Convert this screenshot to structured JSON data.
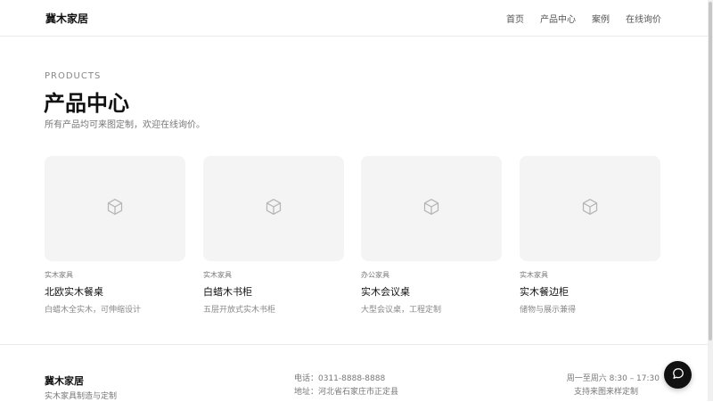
{
  "header": {
    "brand": "冀木家居",
    "nav": [
      {
        "label": "首页"
      },
      {
        "label": "产品中心"
      },
      {
        "label": "案例"
      },
      {
        "label": "在线询价"
      }
    ]
  },
  "hero": {
    "eyebrow": "PRODUCTS",
    "title": "产品中心",
    "subtitle": "所有产品均可来图定制，欢迎在线询价。"
  },
  "products": [
    {
      "category": "实木家具",
      "name": "北欧实木餐桌",
      "desc": "白蜡木全实木，可伸缩设计",
      "icon": "box-icon"
    },
    {
      "category": "实木家具",
      "name": "白蜡木书柜",
      "desc": "五层开放式实木书柜",
      "icon": "box-icon"
    },
    {
      "category": "办公家具",
      "name": "实木会议桌",
      "desc": "大型会议桌，工程定制",
      "icon": "box-icon"
    },
    {
      "category": "实木家具",
      "name": "实木餐边柜",
      "desc": "储物与展示兼得",
      "icon": "box-icon"
    }
  ],
  "footer": {
    "brand": "冀木家居",
    "tagline": "实木家具制造与定制",
    "phone": "电话：0311-8888-8888",
    "address": "地址：河北省石家庄市正定县",
    "hours": "周一至周六 8:30 – 17:30",
    "note": "支持来图来样定制"
  },
  "chat": {
    "icon": "chat-bubble-icon"
  },
  "colors": {
    "accent": "#111111",
    "card_bg": "#f4f4f4",
    "muted": "#777777"
  }
}
